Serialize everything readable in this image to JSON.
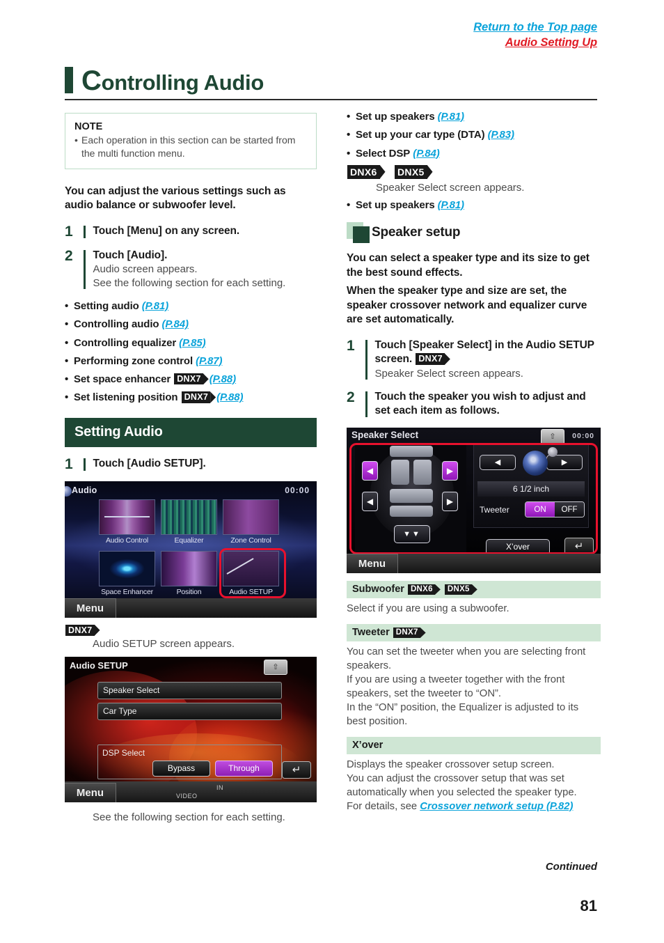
{
  "top_links": {
    "return": "Return to the Top page",
    "audio_setting": "Audio Setting Up"
  },
  "title": {
    "dropcap": "C",
    "rest": "ontrolling Audio"
  },
  "note": {
    "heading": "NOTE",
    "item": "Each operation in this section can be started from the multi function menu."
  },
  "left": {
    "lead": "You can adjust the various settings such as audio balance or subwoofer level.",
    "step1": {
      "num": "1",
      "head": "Touch [Menu] on any screen."
    },
    "step2": {
      "num": "2",
      "head": "Touch [Audio].",
      "sub1": "Audio screen appears.",
      "sub2": "See the following section for each setting."
    },
    "bullets": [
      {
        "label": "Setting audio",
        "page": "(P.81)"
      },
      {
        "label": "Controlling audio",
        "page": "(P.84)"
      },
      {
        "label": "Controlling equalizer",
        "page": "(P.85)"
      },
      {
        "label": "Performing zone control",
        "page": "(P.87)"
      },
      {
        "label": "Set space enhancer",
        "badge": "DNX7",
        "page": "(P.88)"
      },
      {
        "label": "Set listening position",
        "badge": "DNX7",
        "page": "(P.88)"
      }
    ],
    "section_header": "Setting Audio",
    "step_setup": {
      "num": "1",
      "head": "Touch [Audio SETUP]."
    },
    "dnx7_badge": "DNX7",
    "setup_appears": "Audio SETUP screen appears.",
    "see_following": "See the following section for each setting."
  },
  "audio_screen": {
    "title": "Audio",
    "clock": "00:00",
    "tiles": [
      "Audio Control",
      "Equalizer",
      "Zone Control",
      "Space Enhancer",
      "Position",
      "Audio SETUP"
    ],
    "menu": "Menu",
    "highlight_tile": "Audio SETUP"
  },
  "audio_setup_screen": {
    "title": "Audio SETUP",
    "rows": [
      "Speaker Select",
      "Car Type"
    ],
    "dsp_label": "DSP Select",
    "dsp_options": [
      "Bypass",
      "Through"
    ],
    "dsp_selected": "Through",
    "back_icon": "back-arrow",
    "menu": "Menu",
    "video_tag": "VIDEO",
    "in_tag": "IN"
  },
  "right": {
    "bullets_top": [
      {
        "label": "Set up speakers",
        "page": "(P.81)",
        "underline": true
      },
      {
        "label": "Set up your car type (DTA)",
        "page": "(P.83)",
        "underline": true
      },
      {
        "label": "Select DSP",
        "page": "(P.84)",
        "underline": true
      }
    ],
    "badges_dnx65": [
      "DNX6",
      "DNX5"
    ],
    "speaker_select_appears": "Speaker Select screen appears.",
    "bullet_after": {
      "label": "Set up speakers",
      "page": "(P.81)"
    },
    "sub_head": "Speaker setup",
    "para1": "You can select a speaker type and its size to get the best sound effects.",
    "para2": "When the speaker type and size are set, the speaker crossover network and equalizer curve are set automatically.",
    "step1": {
      "num": "1",
      "head_a": "Touch [Speaker Select] in the Audio SETUP screen.",
      "badge": "DNX7",
      "sub": "Speaker Select screen appears."
    },
    "step2": {
      "num": "2",
      "head": "Touch the speaker you wish to adjust and set each item as follows."
    },
    "defs": [
      {
        "label": "Subwoofer",
        "badges": [
          "DNX6",
          "DNX5"
        ],
        "body": [
          "Select if you are using a subwoofer."
        ]
      },
      {
        "label": "Tweeter",
        "badges": [
          "DNX7"
        ],
        "body": [
          "You can set the tweeter when you are selecting front speakers.",
          "If you are using a tweeter together with the front speakers, set the tweeter to “ON”.",
          "In the “ON” position, the Equalizer is adjusted to its best position."
        ]
      },
      {
        "label": "X’over",
        "badges": [],
        "body": [
          "Displays the speaker crossover setup screen.",
          "You can adjust the crossover setup that was set automatically when you selected the speaker type."
        ],
        "link_prefix": "For details, see ",
        "link": "Crossover network setup (P.82)"
      }
    ]
  },
  "speaker_select_screen": {
    "title": "Speaker Select",
    "clock": "00:00",
    "size_value": "6 1/2 inch",
    "tweeter_label": "Tweeter",
    "tweeter_on": "ON",
    "tweeter_off": "OFF",
    "tweeter_selected": "ON",
    "xover_button": "X’over",
    "menu": "Menu",
    "left_arrow": "◀",
    "right_arrow": "▶",
    "back_icon": "back-arrow"
  },
  "footer": {
    "continued": "Continued",
    "page_number": "81"
  },
  "colors": {
    "dark_green": "#1e4734",
    "light_green": "#cfe6d4",
    "link_cyan": "#0aa3da",
    "link_red": "#e01b24",
    "highlight_red": "#e8112d",
    "accent_purple": "#8e16b6"
  }
}
